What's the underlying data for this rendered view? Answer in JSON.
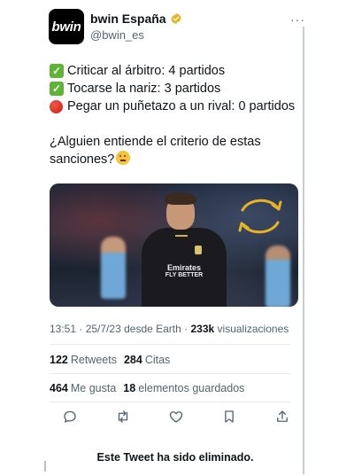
{
  "account": {
    "logo_text": "bwin",
    "display_name": "bwin España",
    "handle": "@bwin_es",
    "more_icon": "more-icon"
  },
  "tweet": {
    "lines": [
      {
        "icon": "check-mark-icon",
        "text": "Criticar al árbitro: 4 partidos"
      },
      {
        "icon": "check-mark-icon",
        "text": "Tocarse la nariz: 3 partidos"
      },
      {
        "icon": "red-circle-icon",
        "text": "Pegar un puñetazo a un rival: 0 partidos"
      }
    ],
    "question": "¿Alguien entiende el criterio de estas sanciones?",
    "question_emoji": "thinking-face-icon"
  },
  "media": {
    "sponsor_line1": "Emirates",
    "sponsor_line2": "FLY BETTER"
  },
  "meta": {
    "time": "13:51",
    "date": "25/7/23",
    "source": "desde Earth",
    "views_count": "233k",
    "views_label": "visualizaciones"
  },
  "stats": {
    "retweets_count": "122",
    "retweets_label": "Retweets",
    "quotes_count": "284",
    "quotes_label": "Citas",
    "likes_count": "464",
    "likes_label": "Me gusta",
    "bookmarks_count": "18",
    "bookmarks_label": "elementos guardados"
  },
  "actions": [
    "reply-icon",
    "retweet-icon",
    "like-icon",
    "bookmark-icon",
    "share-icon"
  ],
  "deleted_notice": "Este Tweet ha sido eliminado.",
  "colors": {
    "check_green": "#5fb336",
    "gold": "#e6b325",
    "muted": "#536471",
    "text": "#0f1419"
  }
}
